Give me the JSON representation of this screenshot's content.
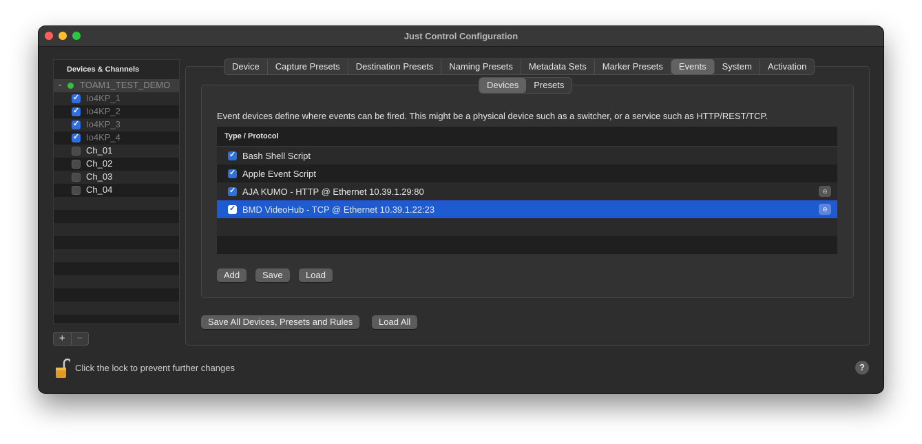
{
  "window": {
    "title": "Just Control Configuration"
  },
  "sidebar": {
    "header": "Devices & Channels",
    "group": {
      "label": "TOAM1_TEST_DEMO",
      "chevron": "⌄"
    },
    "channels": [
      {
        "label": "Io4KP_1",
        "checked": true
      },
      {
        "label": "Io4KP_2",
        "checked": true
      },
      {
        "label": "Io4KP_3",
        "checked": true
      },
      {
        "label": "Io4KP_4",
        "checked": true
      },
      {
        "label": "Ch_01",
        "checked": false
      },
      {
        "label": "Ch_02",
        "checked": false
      },
      {
        "label": "Ch_03",
        "checked": false
      },
      {
        "label": "Ch_04",
        "checked": false
      }
    ],
    "add_symbol": "+",
    "remove_symbol": "−"
  },
  "tabs": [
    "Device",
    "Capture Presets",
    "Destination Presets",
    "Naming Presets",
    "Metadata Sets",
    "Marker Presets",
    "Events",
    "System",
    "Activation"
  ],
  "selected_tab": "Events",
  "subtabs": [
    "Devices",
    "Presets"
  ],
  "selected_subtab": "Devices",
  "events": {
    "description": "Event devices define where events can be fired. This might be a physical device such as a switcher, or a service such as HTTP/REST/TCP.",
    "column_header": "Type / Protocol",
    "rows": [
      {
        "label": "Bash Shell Script",
        "checked": true,
        "has_action": false
      },
      {
        "label": "Apple Event Script",
        "checked": true,
        "has_action": false
      },
      {
        "label": "AJA KUMO - HTTP @ Ethernet 10.39.1.29:80",
        "checked": true,
        "has_action": true
      },
      {
        "label": "BMD VideoHub - TCP @ Ethernet 10.39.1.22:23",
        "checked": true,
        "has_action": true,
        "selected": true
      }
    ],
    "action_glyph": "⊖",
    "add_label": "Add",
    "save_label": "Save",
    "load_label": "Load"
  },
  "footer": {
    "save_all_label": "Save All Devices, Presets and Rules",
    "load_all_label": "Load All",
    "lock_text": "Click the lock to prevent further changes",
    "help_symbol": "?"
  },
  "colors": {
    "accent": "#1e5bd1",
    "status_green": "#32c13a",
    "lock": "#e09a20"
  }
}
